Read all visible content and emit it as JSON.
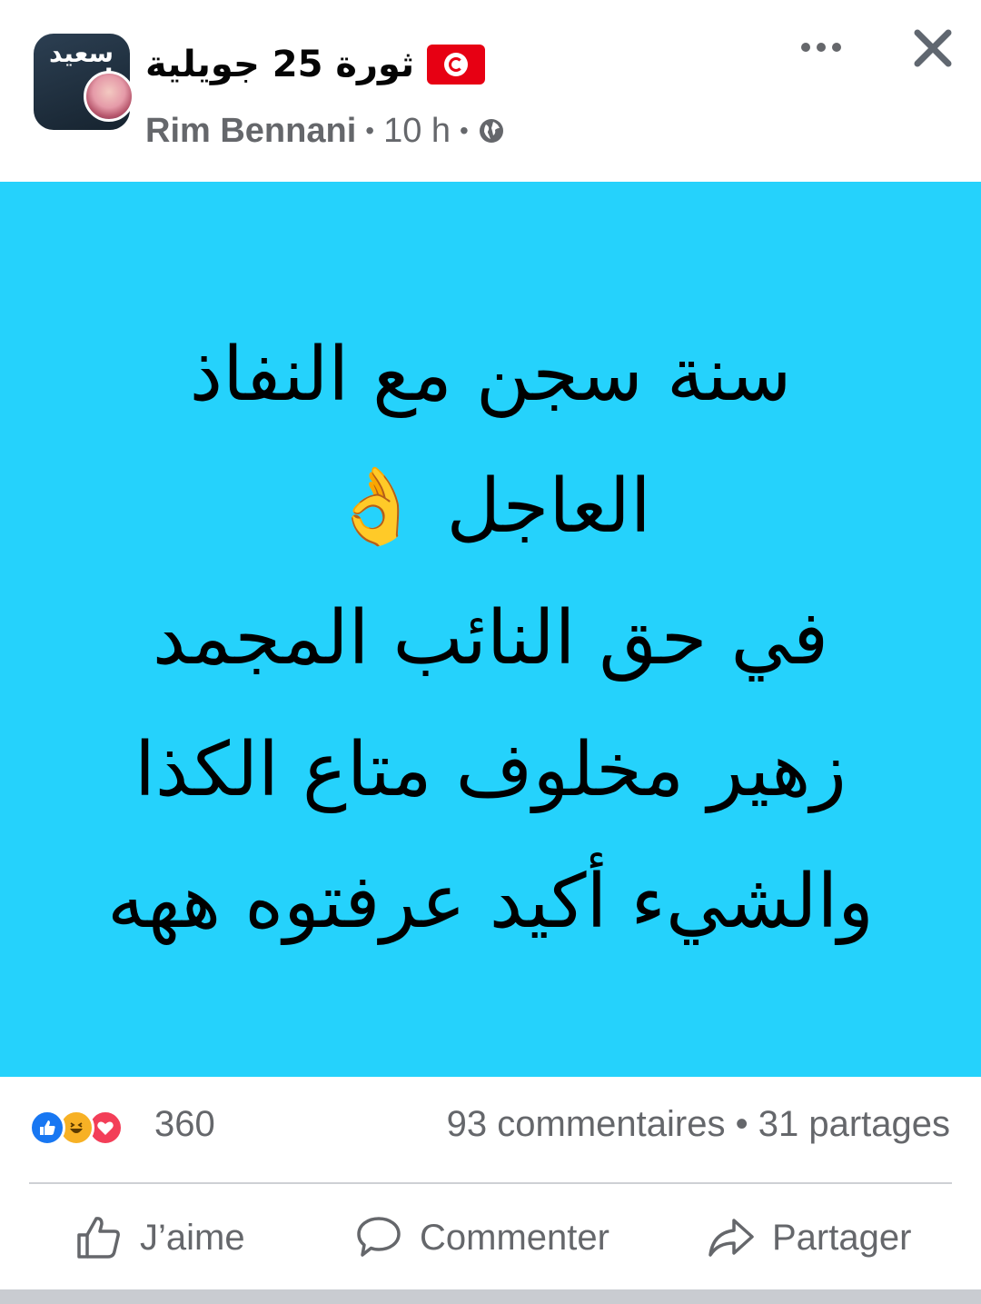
{
  "header": {
    "group_avatar_text": "سعيد ك",
    "group_name": "ثورة 25 جويلية",
    "flag_icon": "tunisia-flag-icon",
    "author": "Rim Bennani",
    "separator": "•",
    "time": "10 h",
    "privacy_icon": "globe-icon",
    "more_icon": "more-options-icon",
    "close_icon": "close-icon"
  },
  "post": {
    "background_color": "#25d2fc",
    "lines": [
      "سنة سجن مع النفاذ",
      "العاجل 👌",
      "في حق النائب المجمد",
      "زهير مخلوف متاع الكذا",
      "والشيء أكيد عرفتوه ههه"
    ]
  },
  "stats": {
    "reaction_icons": [
      "like-reaction-icon",
      "haha-reaction-icon",
      "love-reaction-icon"
    ],
    "reaction_count": "360",
    "comments": "93 commentaires",
    "separator": "•",
    "shares": "31 partages"
  },
  "actions": {
    "like": "J’aime",
    "comment": "Commenter",
    "share": "Partager"
  }
}
